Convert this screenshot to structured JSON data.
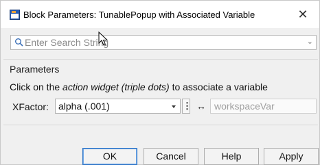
{
  "window": {
    "title": "Block Parameters: TunablePopup with Associated Variable",
    "close_glyph": "✕"
  },
  "search": {
    "placeholder": "Enter Search String",
    "chevron": "⌄"
  },
  "parameters": {
    "section_title": "Parameters",
    "instruction_before": "Click on the ",
    "instruction_emph": "action widget (triple dots)",
    "instruction_after": " to associate a variable",
    "xfactor_label": "XFactor:",
    "xfactor_value": "alpha (.001)",
    "action_widget_glyph": "⋮",
    "link_arrow_glyph": "↔",
    "workspace_var": "workspaceVar"
  },
  "buttons": {
    "ok": "OK",
    "cancel": "Cancel",
    "help": "Help",
    "apply": "Apply"
  },
  "colors": {
    "accent": "#2d73c4"
  }
}
